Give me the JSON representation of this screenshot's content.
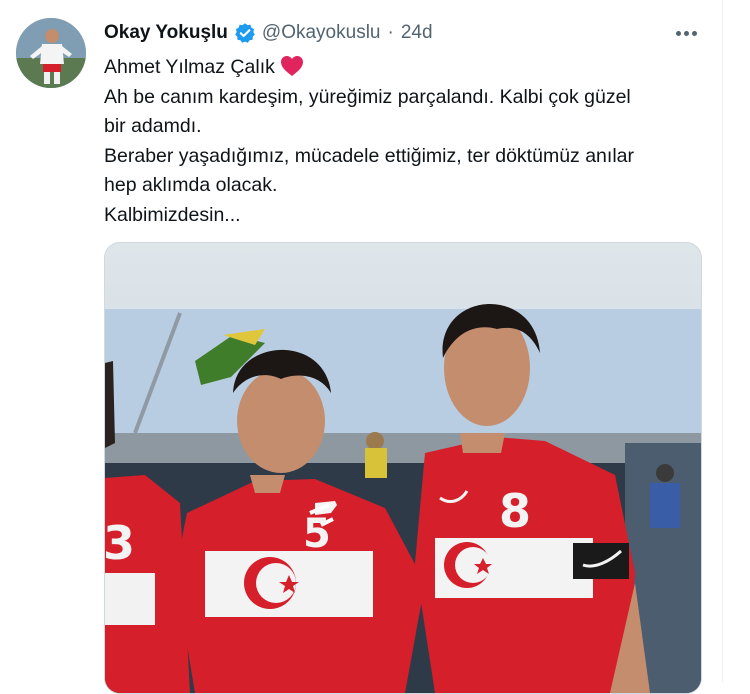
{
  "tweet": {
    "author_name": "Okay Yokuşlu",
    "handle": "@Okayokuslu",
    "separator": "·",
    "time": "24d",
    "lines": [
      "Ahmet Yılmaz Çalık",
      "Ah be canım kardeşim, yüreğimiz parçalandı. Kalbi çok güzel",
      "bir adamdı.",
      "Beraber yaşadığımız, mücadele ettiğimiz, ter döktümüz anılar",
      "hep aklımda olacak.",
      "Kalbimizdesin..."
    ],
    "photo": {
      "jersey_numbers": [
        "3",
        "5",
        "8"
      ]
    }
  },
  "colors": {
    "verified": "#1d9bf0",
    "heart": "#e0245e",
    "jersey_red": "#d51f2b",
    "secondary_text": "#536471"
  },
  "icons": [
    "verified-badge-icon",
    "more-options-icon",
    "red-heart-icon"
  ]
}
